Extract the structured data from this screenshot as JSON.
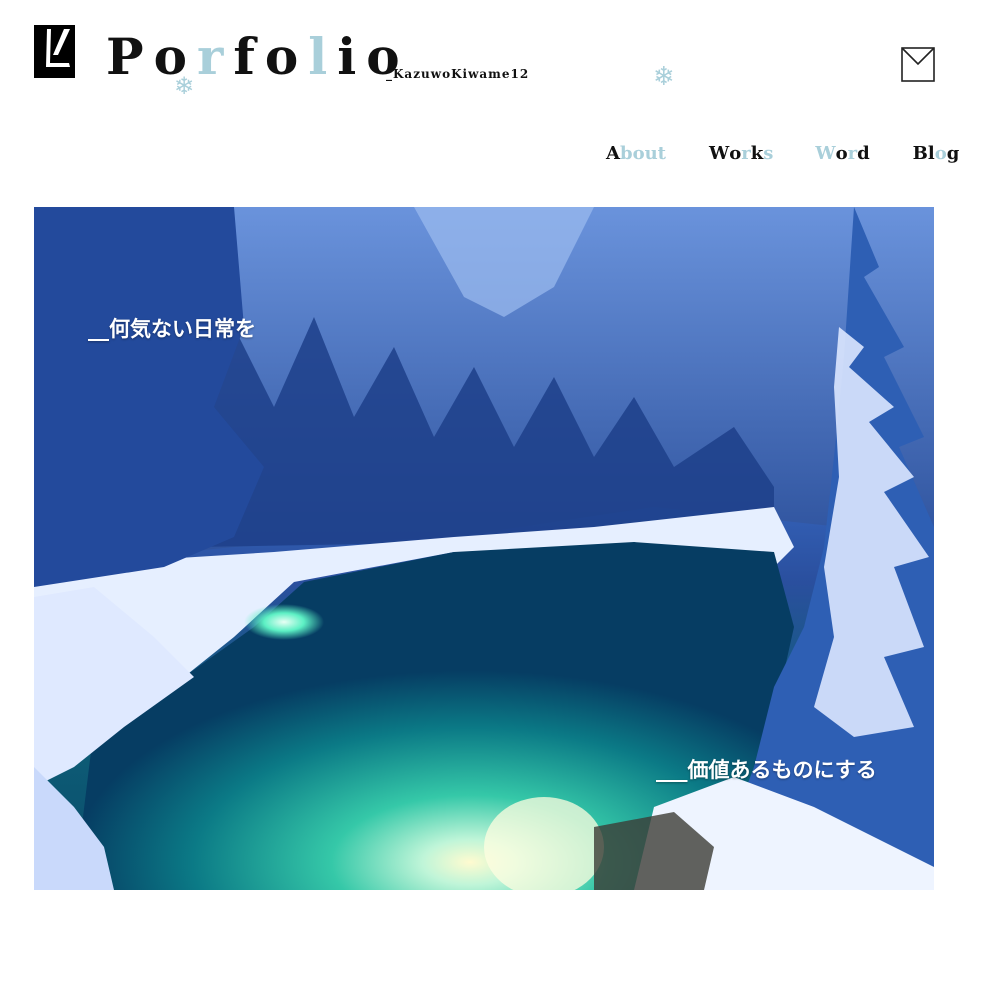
{
  "header": {
    "title_chars": [
      "P",
      "o",
      "r",
      "f",
      "o",
      "l",
      "i",
      "o"
    ],
    "subtitle": "_KazuwoKiwame12",
    "snowflake": "❄"
  },
  "nav": {
    "items": [
      {
        "chars": [
          "A",
          "b",
          "o",
          "u",
          "t"
        ]
      },
      {
        "chars": [
          "W",
          "o",
          "r",
          "k",
          "s"
        ]
      },
      {
        "chars": [
          "W",
          "o",
          "r",
          "d"
        ]
      },
      {
        "chars": [
          "B",
          "l",
          "o",
          "g"
        ]
      }
    ]
  },
  "hero": {
    "caption_top": "__何気ない日常を",
    "caption_bottom": "___価値あるものにする"
  },
  "colors": {
    "accent": "#a9cfda",
    "text": "#111111",
    "background": "#ffffff"
  },
  "icons": {
    "logo": "logo-mark-icon",
    "mail": "envelope-icon",
    "decoration": "snowflake-icon"
  }
}
